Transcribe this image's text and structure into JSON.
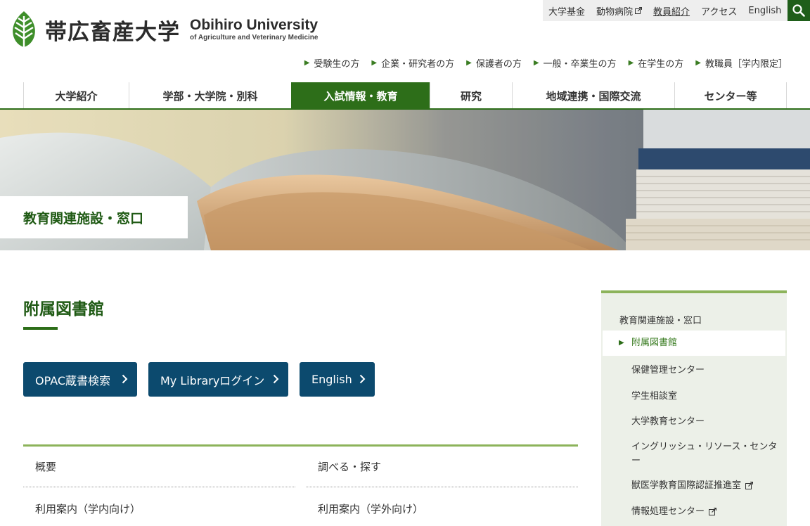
{
  "header": {
    "logo_ja": "帯広畜産大学",
    "logo_en_main": "Obihiro University",
    "logo_en_sub": "of Agriculture and Veterinary Medicine",
    "utility_links": [
      {
        "label": "大学基金",
        "external": false
      },
      {
        "label": "動物病院",
        "external": true
      },
      {
        "label": "教員紹介",
        "external": false
      },
      {
        "label": "アクセス",
        "external": false
      },
      {
        "label": "English",
        "external": false
      }
    ],
    "audience_links": [
      "受験生の方",
      "企業・研究者の方",
      "保護者の方",
      "一般・卒業生の方",
      "在学生の方",
      "教職員［学内限定］"
    ]
  },
  "nav": {
    "items": [
      {
        "label": "大学紹介",
        "active": false
      },
      {
        "label": "学部・大学院・別科",
        "active": false
      },
      {
        "label": "入試情報・教育",
        "active": true
      },
      {
        "label": "研究",
        "active": false
      },
      {
        "label": "地域連携・国際交流",
        "active": false
      },
      {
        "label": "センター等",
        "active": false
      }
    ]
  },
  "hero": {
    "title": "教育関連施設・窓口"
  },
  "main": {
    "title": "附属図書館",
    "buttons": [
      "OPAC蔵書検索",
      "My Libraryログイン",
      "English"
    ],
    "links": [
      [
        "概要",
        "調べる・探す"
      ],
      [
        "利用案内（学内向け）",
        "利用案内（学外向け）"
      ]
    ]
  },
  "sidebar": {
    "heading": "教育関連施設・窓口",
    "items": [
      {
        "label": "附属図書館",
        "current": true,
        "external": false
      },
      {
        "label": "保健管理センター",
        "current": false,
        "external": false
      },
      {
        "label": "学生相談室",
        "current": false,
        "external": false
      },
      {
        "label": "大学教育センター",
        "current": false,
        "external": false
      },
      {
        "label": "イングリッシュ・リソース・センター",
        "current": false,
        "external": false
      },
      {
        "label": "獣医学教育国際認証推進室",
        "current": false,
        "external": true
      },
      {
        "label": "情報処理センター",
        "current": false,
        "external": true
      }
    ]
  },
  "colors": {
    "brand_green": "#2d6e19",
    "accent_light_green": "#8cb35a",
    "button_blue": "#0c4a6e",
    "sidebar_bg": "#ecf0e8"
  },
  "icons": {
    "logo": "leaf-icon",
    "search": "search-icon",
    "external": "external-link-icon",
    "chevron": "chevron-right-icon",
    "bullet": "triangle-right-icon"
  }
}
